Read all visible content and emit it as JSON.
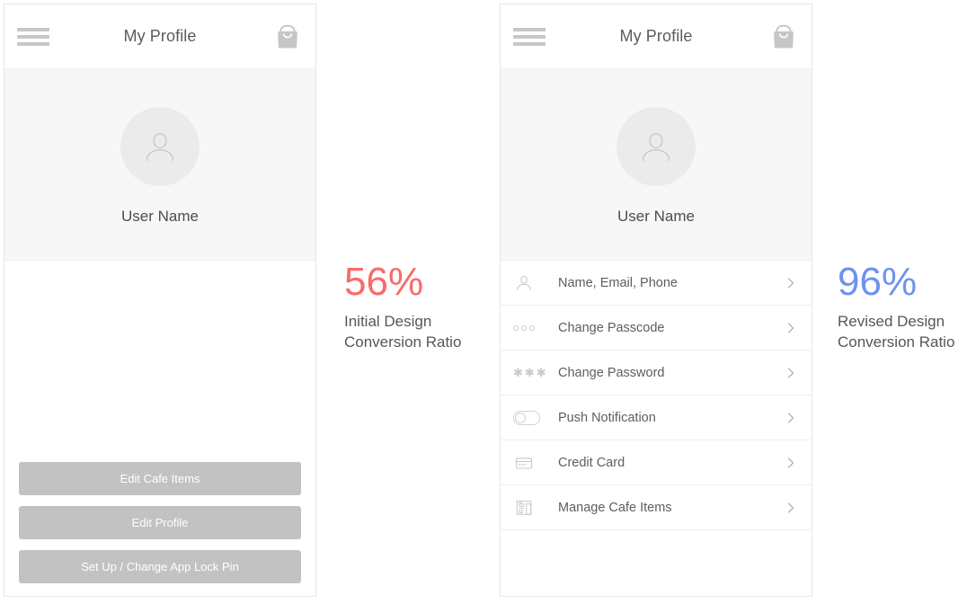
{
  "screens": [
    {
      "id": "initial-design",
      "appbar": {
        "title": "My Profile",
        "menu_icon": "hamburger-icon",
        "bag_icon": "shopping-bag-icon"
      },
      "profile": {
        "avatar_icon": "user-avatar-icon",
        "username": "User Name"
      },
      "buttons": [
        {
          "label": "Edit Cafe Items"
        },
        {
          "label": "Edit Profile"
        },
        {
          "label": "Set Up / Change App Lock Pin"
        }
      ]
    },
    {
      "id": "revised-design",
      "appbar": {
        "title": "My Profile",
        "menu_icon": "hamburger-icon",
        "bag_icon": "shopping-bag-icon"
      },
      "profile": {
        "avatar_icon": "user-avatar-icon",
        "username": "User Name"
      },
      "rows": [
        {
          "label": "Name, Email, Phone",
          "icon": "person-icon",
          "chevron": "chevron-right-icon"
        },
        {
          "label": "Change Passcode",
          "icon": "passcode-dots-icon",
          "chevron": "chevron-right-icon"
        },
        {
          "label": "Change Password",
          "icon": "password-asterisks-icon",
          "chevron": "chevron-right-icon"
        },
        {
          "label": "Push Notification",
          "icon": "toggle-switch-icon",
          "chevron": "chevron-right-icon"
        },
        {
          "label": "Credit Card",
          "icon": "credit-card-icon",
          "chevron": "chevron-right-icon"
        },
        {
          "label": "Manage Cafe Items",
          "icon": "coffee-machine-icon",
          "chevron": "chevron-right-icon"
        }
      ]
    }
  ],
  "captions": {
    "left": {
      "percent": "56%",
      "line1": "Initial Design",
      "line2": "Conversion Ratio",
      "color": "#fa6a6a"
    },
    "right": {
      "percent": "96%",
      "line1": "Revised Design",
      "line2": "Conversion Ratio",
      "color": "#6d93f0"
    }
  },
  "colors": {
    "button_fill": "#c2c2c2",
    "hero_background": "#f7f7f7",
    "panel_border": "#e6e6e6",
    "icon_gray": "#c6c6c6",
    "text_gray": "#5e5e5e"
  }
}
